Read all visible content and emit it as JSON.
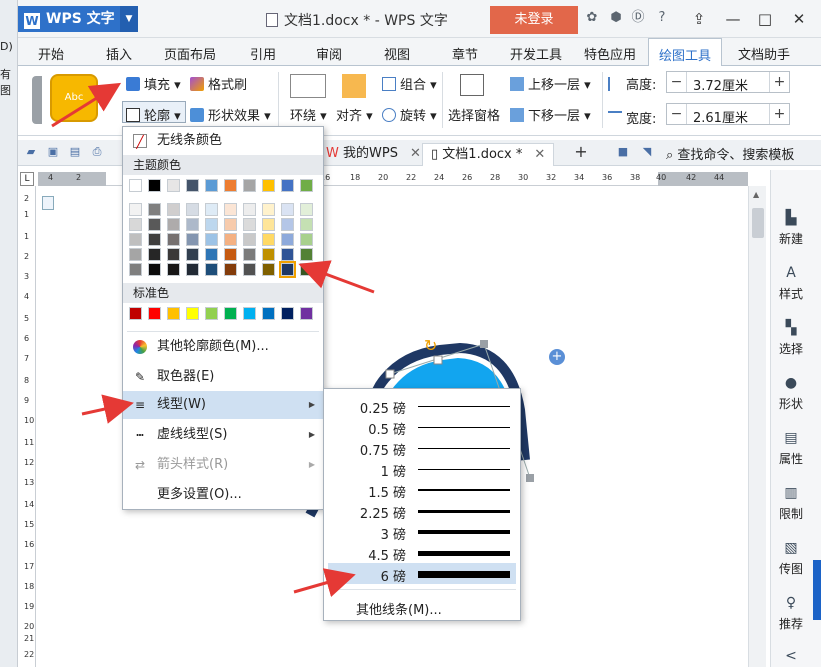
{
  "outside_strip": {
    "texts": [
      "D)",
      "有图"
    ]
  },
  "titlebar": {
    "app_name": "WPS 文字",
    "app_logo": "W",
    "document_title": "文档1.docx * - WPS 文字",
    "login_label": "未登录"
  },
  "ribbon_tabs": [
    "开始",
    "插入",
    "页面布局",
    "引用",
    "审阅",
    "视图",
    "章节",
    "开发工具",
    "特色应用",
    "绘图工具",
    "文档助手"
  ],
  "active_ribbon_tab": "绘图工具",
  "ribbon": {
    "gallery_sample_text": "Abc",
    "fill_label": "填充",
    "format_painter_label": "格式刷",
    "outline_label": "轮廓",
    "shape_effects_label": "形状效果",
    "wrap_label": "环绕",
    "align_label": "对齐",
    "group_label": "组合",
    "rotate_label": "旋转",
    "selection_pane_label": "选择窗格",
    "bring_forward_label": "上移一层",
    "send_backward_label": "下移一层",
    "height_label": "高度:",
    "height_value": "3.72厘米",
    "width_label": "宽度:",
    "width_value": "2.61厘米"
  },
  "doc_tabs": {
    "my_wps": "我的WPS",
    "document": "文档1.docx *",
    "search_label": "查找命令、搜索模板"
  },
  "ruler": {
    "h_ticks": [
      "4",
      "2",
      "2",
      "4",
      "16",
      "18",
      "20",
      "22",
      "24",
      "26",
      "28",
      "30",
      "32",
      "34",
      "36",
      "38",
      "40",
      "42",
      "44"
    ],
    "v_ticks": [
      "2",
      "1",
      "1",
      "2",
      "3",
      "4",
      "5",
      "6",
      "7",
      "8",
      "9",
      "10",
      "11",
      "12",
      "13",
      "14",
      "15",
      "16",
      "17",
      "18",
      "19",
      "20",
      "21",
      "22"
    ],
    "corner": "L"
  },
  "right_panel": [
    "新建",
    "样式",
    "选择",
    "形状",
    "属性",
    "限制",
    "传图",
    "推荐"
  ],
  "outline_menu": {
    "no_line_color": "无线条颜色",
    "theme_colors_label": "主题颜色",
    "standard_colors_label": "标准色",
    "more_colors": "其他轮廓颜色(M)...",
    "eyedropper": "取色器(E)",
    "line_type": "线型(W)",
    "dash_type": "虚线线型(S)",
    "arrow_style": "箭头样式(R)",
    "more_settings": "更多设置(O)...",
    "theme_top_row": [
      "#ffffff",
      "#000000",
      "#e7e6e6",
      "#44546a",
      "#5b9bd5",
      "#ed7d31",
      "#a5a5a5",
      "#ffc000",
      "#4472c4",
      "#70ad47"
    ],
    "theme_shades": [
      [
        "#f2f2f2",
        "#7f7f7f",
        "#d0cece",
        "#d6dce4",
        "#deebf6",
        "#fbe5d5",
        "#ededed",
        "#fff2cc",
        "#dae3f3",
        "#e2efd9"
      ],
      [
        "#d8d8d8",
        "#595959",
        "#aeabab",
        "#adb9ca",
        "#bdd7ee",
        "#f7cbac",
        "#dbdbdb",
        "#fee599",
        "#b4c6e7",
        "#c5e0b3"
      ],
      [
        "#bfbfbf",
        "#3f3f3f",
        "#757070",
        "#8496b0",
        "#9dc3e6",
        "#f4b183",
        "#c9c9c9",
        "#ffd965",
        "#8eaadb",
        "#a8d08d"
      ],
      [
        "#a5a5a5",
        "#262626",
        "#3a3838",
        "#323f4f",
        "#2e75b5",
        "#c55a11",
        "#7b7b7b",
        "#bf9000",
        "#2f5496",
        "#538135"
      ],
      [
        "#7f7f7f",
        "#0c0c0c",
        "#171616",
        "#222a35",
        "#1e4e79",
        "#833c0b",
        "#525252",
        "#7f6000",
        "#1f3864",
        "#375623"
      ]
    ],
    "standard_colors": [
      "#c00000",
      "#ff0000",
      "#ffc000",
      "#ffff00",
      "#92d050",
      "#00b050",
      "#00b0f0",
      "#0070c0",
      "#002060",
      "#7030a0"
    ]
  },
  "line_weight_submenu": {
    "weights": [
      "0.25 磅",
      "0.5 磅",
      "0.75 磅",
      "1 磅",
      "1.5 磅",
      "2.25 磅",
      "3 磅",
      "4.5 磅",
      "6 磅"
    ],
    "weight_values_pt": [
      0.25,
      0.5,
      0.75,
      1,
      1.5,
      2.25,
      3,
      4.5,
      6
    ],
    "selected": "6 磅",
    "more_lines": "其他线条(M)..."
  },
  "colors": {
    "accent_blue": "#2e71c9",
    "login_red": "#e2674a",
    "menu_highlight": "#cfe0f2",
    "shape_fill": "#12a5ef",
    "shape_outline": "#1f3864",
    "annotation_arrow": "#e53935"
  },
  "icons": [
    "wps-logo-icon",
    "document-icon",
    "settings-icon",
    "skin-icon",
    "help-icon",
    "minimize-icon",
    "maximize-icon",
    "close-icon",
    "fill-bucket-icon",
    "format-brush-icon",
    "outline-pen-icon",
    "shape-effect-icon",
    "wrap-icon",
    "align-icon",
    "group-icon",
    "rotate-icon",
    "selection-pane-icon",
    "bring-forward-icon",
    "send-backward-icon",
    "height-icon",
    "width-icon",
    "no-line-icon",
    "color-wheel-icon",
    "eyedropper-icon",
    "line-type-icon",
    "dash-icon",
    "arrow-style-icon",
    "rotate-handle-icon",
    "add-icon",
    "search-icon"
  ]
}
